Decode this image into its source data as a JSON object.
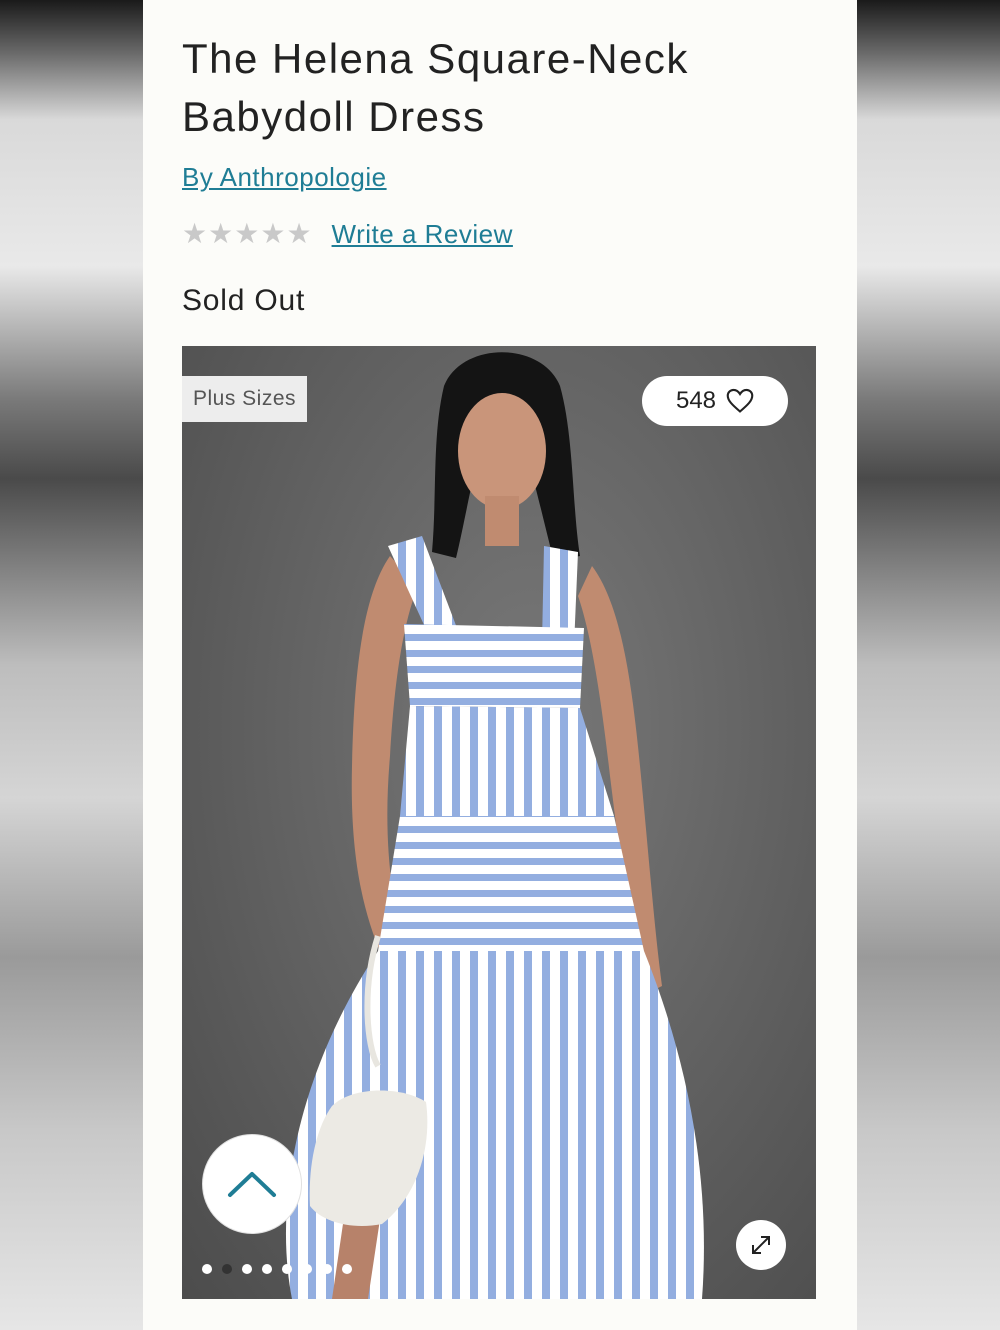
{
  "product": {
    "title": "The Helena Square-Neck Babydoll Dress",
    "brand": "By Anthropologie",
    "rating": {
      "value": 0,
      "max": 5,
      "review_link": "Write a Review"
    },
    "status": "Sold Out"
  },
  "gallery": {
    "badge": "Plus Sizes",
    "likes_count": "548",
    "image_count": 8,
    "active_index": 1
  },
  "icons": {
    "heart": "heart-icon",
    "scroll_top": "chevron-up-icon",
    "expand": "expand-arrows-icon",
    "star": "star-icon"
  },
  "colors": {
    "link": "#1f7d95",
    "background": "#fcfcf9",
    "star_empty": "#c9c9c9"
  }
}
